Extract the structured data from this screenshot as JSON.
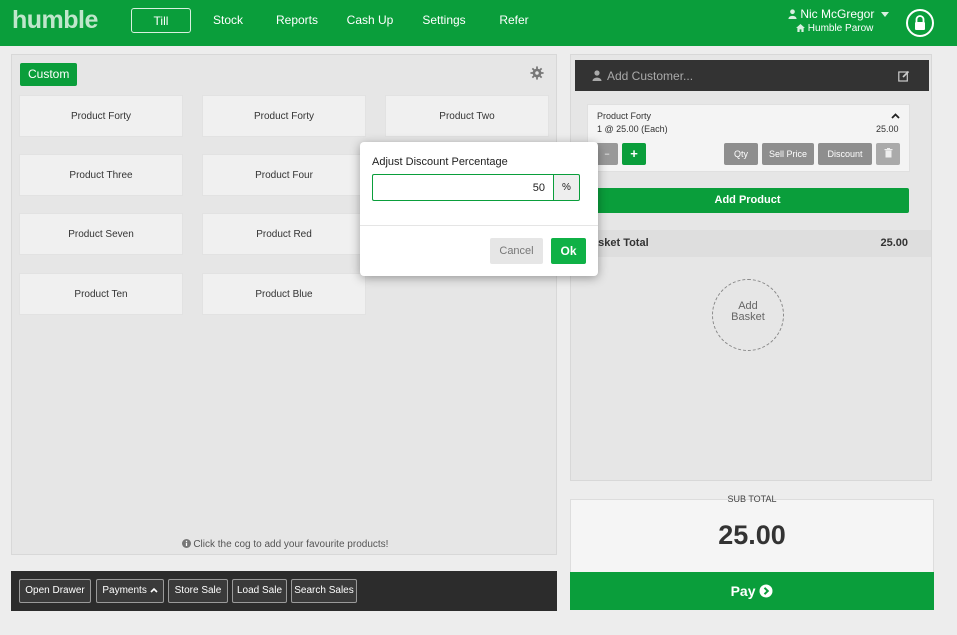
{
  "header": {
    "logo": "humble",
    "nav": [
      "Till",
      "Stock",
      "Reports",
      "Cash Up",
      "Settings",
      "Refer"
    ],
    "user_name": "Nic McGregor",
    "store_name": "Humble Parow"
  },
  "products_panel": {
    "tab_label": "Custom",
    "products": [
      "Product Forty",
      "Product Forty",
      "Product Two",
      "Product Three",
      "Product Four",
      "Product Seven",
      "Product Red",
      "Product Ten",
      "Product Blue"
    ],
    "hint": "Click the cog to add your favourite products!"
  },
  "bottom_bar": {
    "buttons": [
      "Open Drawer",
      "Payments",
      "Store Sale",
      "Load Sale",
      "Search Sales"
    ]
  },
  "basket": {
    "customer_placeholder": "Add Customer...",
    "line": {
      "name": "Product Forty",
      "detail": "1 @ 25.00 (Each)",
      "total": "25.00"
    },
    "minus": "−",
    "plus": "+",
    "actions": [
      "Qty",
      "Sell Price",
      "Discount"
    ],
    "add_product": "Add Product",
    "total_label": "asket Total",
    "total_value": "25.00",
    "add_basket": [
      "Add",
      "Basket"
    ]
  },
  "subtotal": {
    "label": "SUB TOTAL",
    "amount": "25.00",
    "pay_label": "Pay"
  },
  "modal": {
    "title": "Adjust Discount Percentage",
    "value": "50",
    "unit": "%",
    "cancel": "Cancel",
    "ok": "Ok"
  },
  "colors": {
    "brand": "#0a9e3b",
    "ok": "#0fb146",
    "dark": "#2c2c2c"
  }
}
